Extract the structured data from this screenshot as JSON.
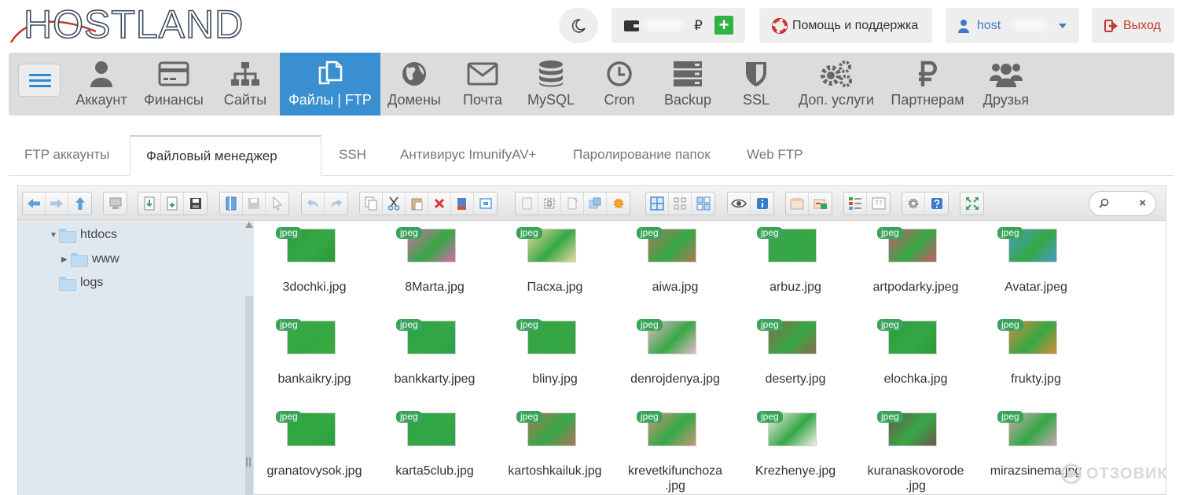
{
  "header": {
    "logo_text": "HOSTLAND",
    "balance_currency": "₽",
    "help_label": "Помощь и поддержка",
    "user_label": "host",
    "logout_label": "Выход"
  },
  "nav": {
    "items": [
      {
        "label": "Аккаунт",
        "icon": "user-icon"
      },
      {
        "label": "Финансы",
        "icon": "credit-card-icon"
      },
      {
        "label": "Сайты",
        "icon": "sitemap-icon"
      },
      {
        "label": "Файлы | FTP",
        "icon": "files-icon",
        "active": true
      },
      {
        "label": "Домены",
        "icon": "globe-icon"
      },
      {
        "label": "Почта",
        "icon": "envelope-icon"
      },
      {
        "label": "MySQL",
        "icon": "database-icon"
      },
      {
        "label": "Cron",
        "icon": "clock-icon"
      },
      {
        "label": "Backup",
        "icon": "server-icon"
      },
      {
        "label": "SSL",
        "icon": "shield-icon"
      },
      {
        "label": "Доп. услуги",
        "icon": "gears-icon"
      },
      {
        "label": "Партнерам",
        "icon": "ruble-icon"
      },
      {
        "label": "Друзья",
        "icon": "users-icon"
      }
    ]
  },
  "subtabs": [
    {
      "label": "FTP аккаунты"
    },
    {
      "label": "Файловый менеджер",
      "active": true
    },
    {
      "label": "SSH"
    },
    {
      "label": "Антивирус ImunifyAV+"
    },
    {
      "label": "Паролирование папок"
    },
    {
      "label": "Web FTP"
    }
  ],
  "tree": {
    "nodes": [
      {
        "label": "htdocs",
        "expanded": true
      },
      {
        "label": "www",
        "expanded": false
      },
      {
        "label": "logs"
      }
    ]
  },
  "files": [
    {
      "name": "3dochki.jpg",
      "badge": "jpeg",
      "color": "#2a9a3a"
    },
    {
      "name": "8Marta.jpg",
      "badge": "jpeg",
      "color": "#d46aa8"
    },
    {
      "name": "Пасха.jpg",
      "badge": "jpeg",
      "color": "#e8d89a"
    },
    {
      "name": "aiwa.jpg",
      "badge": "jpeg",
      "color": "#a87a5a"
    },
    {
      "name": "arbuz.jpg",
      "badge": "jpeg",
      "color": "#3aa24a"
    },
    {
      "name": "artpodarky.jpeg",
      "badge": "jpeg",
      "color": "#c85a6a"
    },
    {
      "name": "Avatar.jpeg",
      "badge": "jpeg",
      "color": "#4a9ac8"
    },
    {
      "name": "bankaikry.jpg",
      "badge": "jpeg",
      "color": "#3aaa3a"
    },
    {
      "name": "bankkarty.jpeg",
      "badge": "jpeg",
      "color": "#2aa24a"
    },
    {
      "name": "bliny.jpg",
      "badge": "jpeg",
      "color": "#3aa040"
    },
    {
      "name": "denrojdenya.jpg",
      "badge": "jpeg",
      "color": "#e8b8c8"
    },
    {
      "name": "deserty.jpg",
      "badge": "jpeg",
      "color": "#8a6a4a"
    },
    {
      "name": "elochka.jpg",
      "badge": "jpeg",
      "color": "#2a9a3a"
    },
    {
      "name": "frukty.jpg",
      "badge": "jpeg",
      "color": "#d88a3a"
    },
    {
      "name": "granatovysok.jpg",
      "badge": "jpeg",
      "color": "#2aa23a"
    },
    {
      "name": "karta5club.jpg",
      "badge": "jpeg",
      "color": "#2aa24a"
    },
    {
      "name": "kartoshkailuk.jpg",
      "badge": "jpeg",
      "color": "#a87a5a"
    },
    {
      "name": "krevetkifunchoza .jpg",
      "badge": "jpeg",
      "color": "#c8987a"
    },
    {
      "name": "Krezhenye.jpg",
      "badge": "jpeg",
      "color": "#f4ece4"
    },
    {
      "name": "kuranaskovorode .jpg",
      "badge": "jpeg",
      "color": "#6a5a4a"
    },
    {
      "name": "mirazsinema.jpg",
      "badge": "jpeg",
      "color": "#c8a8b0"
    }
  ],
  "watermark": "ОТЗОВИК",
  "colors": {
    "accent": "#3a8fd1",
    "nav_bg": "#dcdcdc",
    "badge": "#3aa35a",
    "plus": "#2fb344",
    "logout": "#c0392b"
  }
}
